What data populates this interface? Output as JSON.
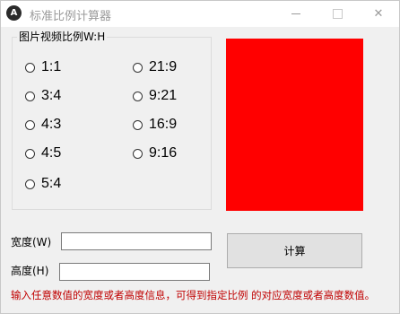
{
  "window": {
    "title": "标准比例计算器",
    "icon_letter": "A",
    "controls": {
      "minimize": "minimize-icon",
      "maximize": "maximize-icon",
      "close": "✕"
    }
  },
  "group": {
    "title": "图片视频比例W:H",
    "left_options": [
      "1:1",
      "3:4",
      "4:3",
      "4:5",
      "5:4"
    ],
    "right_options": [
      "21:9",
      "9:21",
      "16:9",
      "9:16"
    ],
    "selected": "21:9"
  },
  "preview": {
    "color": "#ff0000"
  },
  "width_field": {
    "label": "宽度(W)",
    "value": ""
  },
  "height_field": {
    "label": "高度(H)",
    "value": ""
  },
  "calculate_button": {
    "label": "计算"
  },
  "hint": "输入任意数值的宽度或者高度信息，可得到指定比例 的对应宽度或者高度数值。"
}
